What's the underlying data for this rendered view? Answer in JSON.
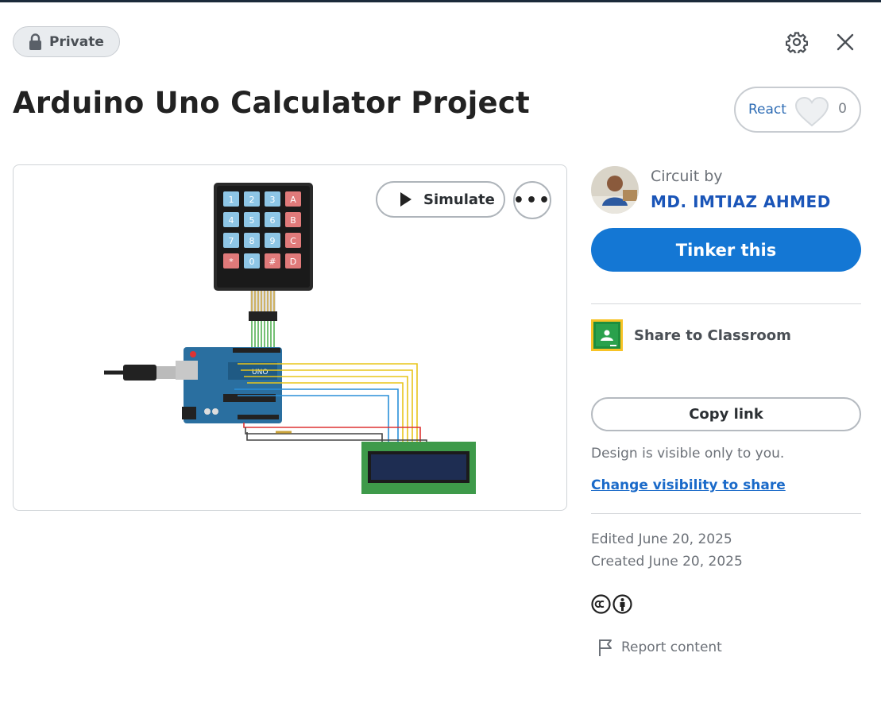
{
  "header": {
    "privacy_label": "Private",
    "title": "Arduino Uno Calculator Project"
  },
  "react": {
    "label": "React",
    "count": "0"
  },
  "canvas": {
    "simulate_label": "Simulate",
    "more_label": "•••",
    "keypad_keys": [
      "1",
      "2",
      "3",
      "A",
      "4",
      "5",
      "6",
      "B",
      "7",
      "8",
      "9",
      "C",
      "*",
      "0",
      "#",
      "D"
    ]
  },
  "author": {
    "circuit_by": "Circuit by",
    "name": "MD. IMTIAZ AHMED"
  },
  "actions": {
    "tinker_label": "Tinker this",
    "share_classroom_label": "Share to Classroom",
    "copy_link_label": "Copy link",
    "visibility_note": "Design is visible only to you.",
    "change_visibility_label": "Change visibility to share"
  },
  "meta": {
    "edited": "Edited June 20, 2025",
    "created": "Created June 20, 2025",
    "report_label": "Report content"
  },
  "colors": {
    "accent": "#1477d4",
    "author_link": "#1a55b8",
    "title": "#222222"
  }
}
